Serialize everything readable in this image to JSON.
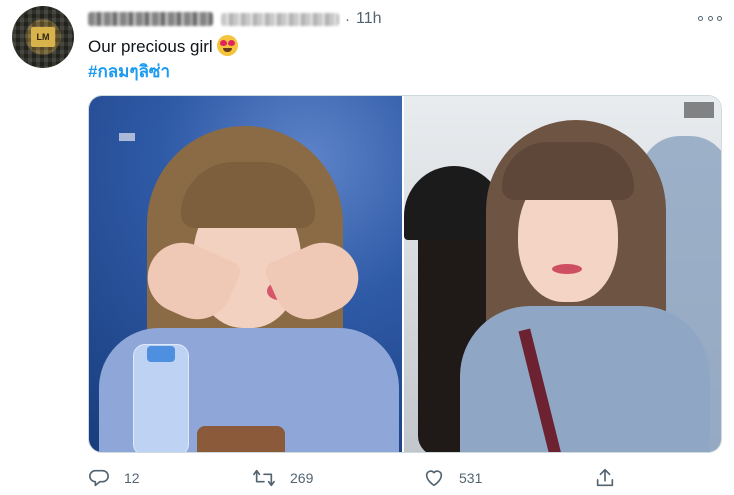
{
  "tweet": {
    "time": "11h",
    "separator": "·",
    "text": "Our precious girl",
    "emoji": "heart-eyes-emoji",
    "hashtag": "#กลมๆลิซ่า",
    "avatar_logo": "LM"
  },
  "actions": {
    "reply_count": "12",
    "retweet_count": "269",
    "like_count": "531"
  },
  "colors": {
    "link": "#1d9bf0",
    "secondary_text": "#536471",
    "border": "#cfd9de"
  },
  "icons": [
    "more-icon",
    "reply-icon",
    "retweet-icon",
    "like-icon",
    "share-icon"
  ]
}
